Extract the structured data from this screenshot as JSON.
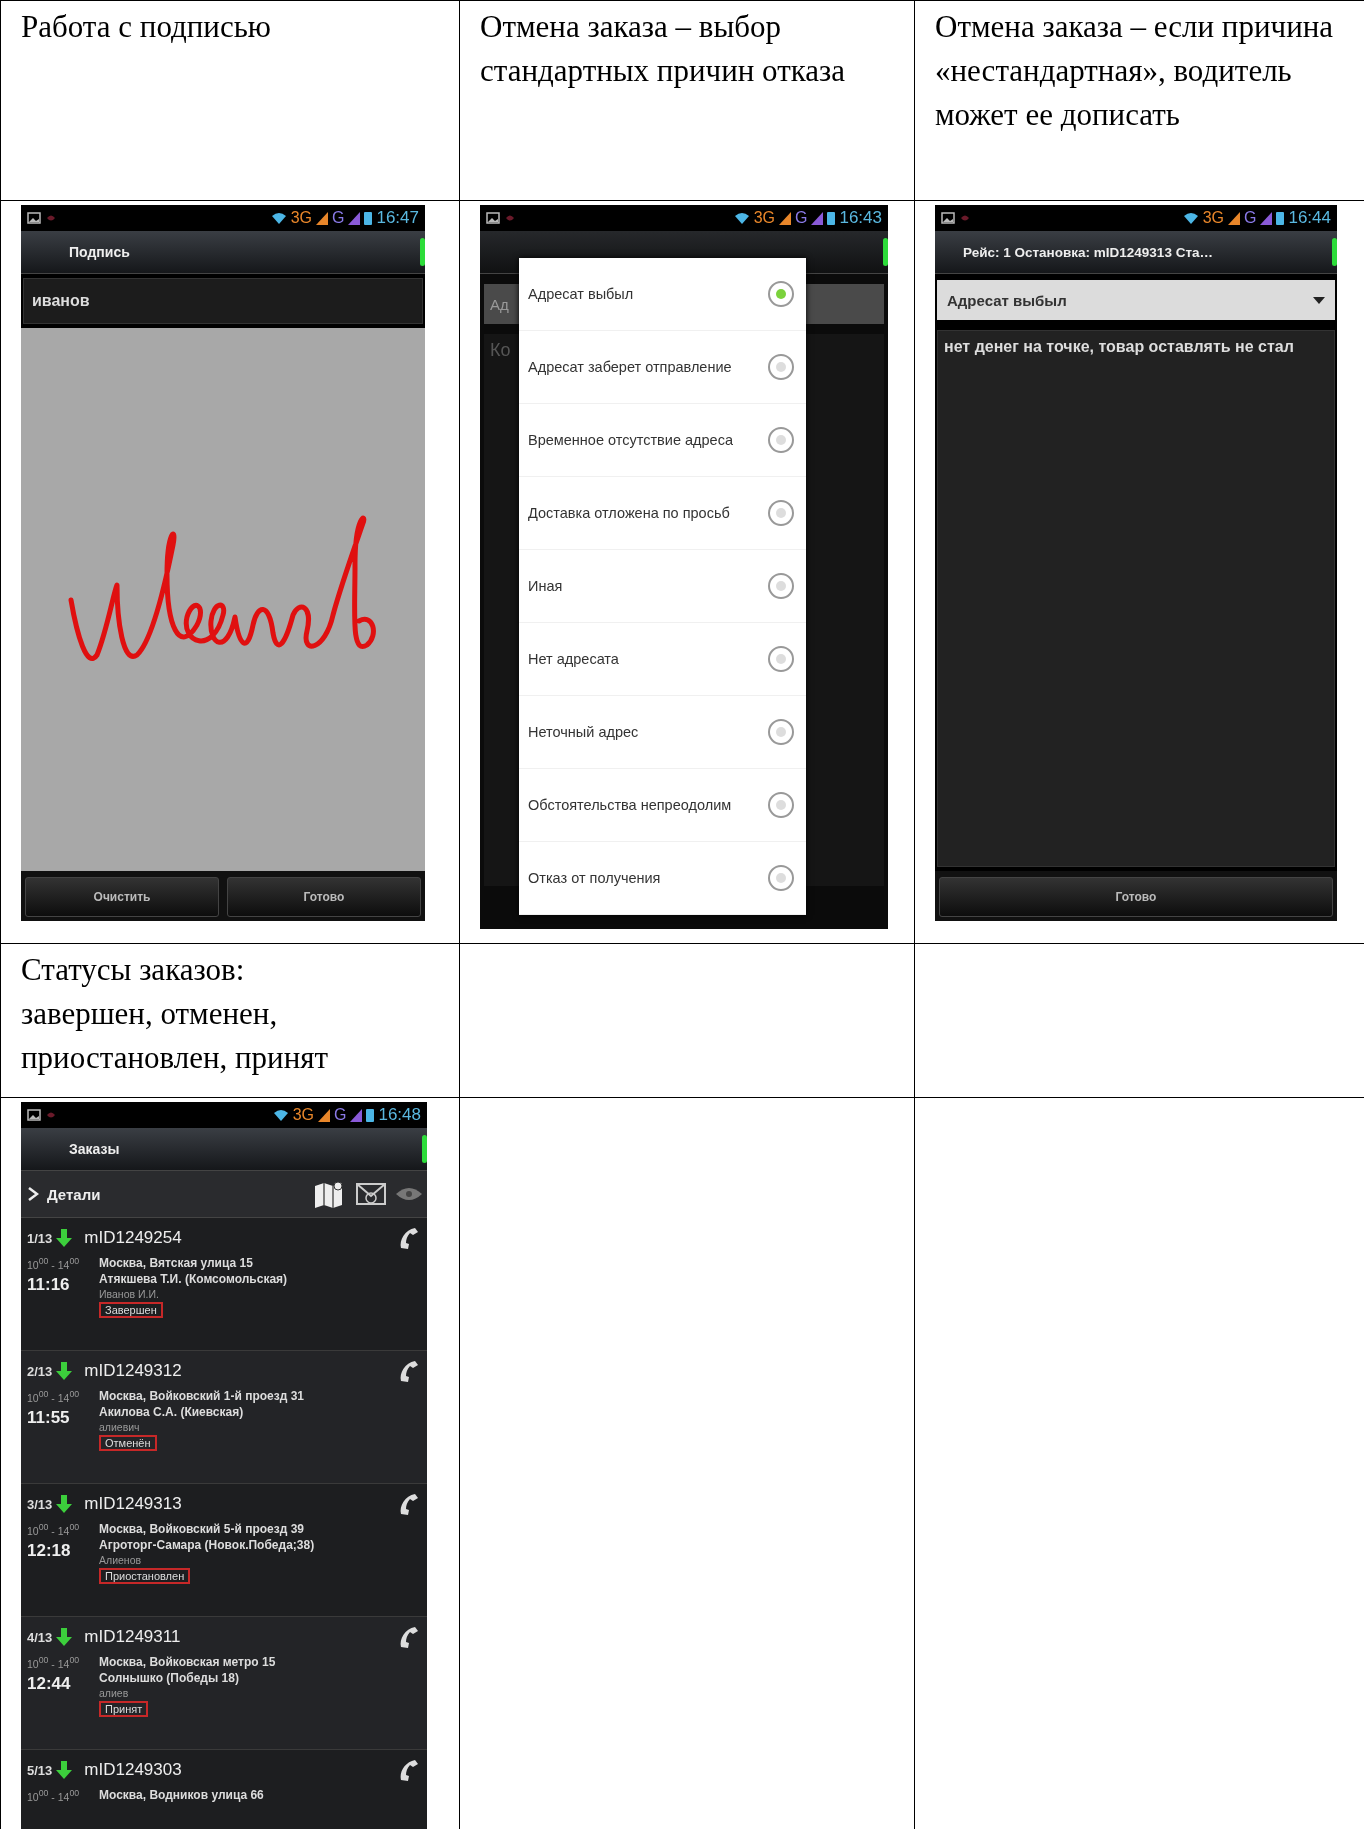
{
  "table": {
    "rows": [
      {
        "kind": "caption",
        "cells": [
          "Работа с подписью",
          "Отмена заказа – выбор стандартных причин отказа",
          "Отмена заказа – если причина «нестандартная», водитель может ее дописать"
        ]
      },
      {
        "kind": "screens",
        "cells": [
          {
            "kind": "signature",
            "status_bar": {
              "network_1": "3G",
              "network_2": "G",
              "time": "16:47"
            },
            "title": "Подпись",
            "name_value": "иванов",
            "buttons": [
              "Очистить",
              "Готово"
            ]
          },
          {
            "kind": "picker",
            "status_bar": {
              "network_1": "3G",
              "network_2": "G",
              "time": "16:43"
            },
            "behind": [
              "Ад",
              "Ко"
            ],
            "options": [
              {
                "label": "Адресат выбыл",
                "selected": true
              },
              {
                "label": "Адресат заберет отправление",
                "selected": false
              },
              {
                "label": "Временное отсутствие адреса",
                "selected": false
              },
              {
                "label": "Доставка отложена по просьб",
                "selected": false
              },
              {
                "label": "Иная",
                "selected": false
              },
              {
                "label": "Нет адресата",
                "selected": false
              },
              {
                "label": "Неточный адрес",
                "selected": false
              },
              {
                "label": "Обстоятельства непреодолим",
                "selected": false
              },
              {
                "label": "Отказ от получения",
                "selected": false
              }
            ]
          },
          {
            "kind": "comment",
            "status_bar": {
              "network_1": "3G",
              "network_2": "G",
              "time": "16:44"
            },
            "title": "Рейс: 1 Остановка: mID1249313 Ста…",
            "reason": "Адресат выбыл",
            "comment_value": "нет денег на точке,  товар оставлять не стал",
            "buttons": [
              "Готово"
            ]
          }
        ]
      },
      {
        "kind": "caption",
        "cells": [
          "Статусы заказов: завершен, отменен, приостановлен, принят"
        ]
      },
      {
        "kind": "screens",
        "cells": [
          {
            "kind": "orders",
            "status_bar": {
              "network_1": "3G",
              "network_2": "G",
              "time": "16:48"
            },
            "title": "Заказы",
            "details": "Детали",
            "orders": [
              {
                "number": "1/13",
                "id": "mID1249254",
                "window": "10$^{00}$ - 14$^{00}$",
                "time": "11:16",
                "address": "Москва, Вятская улица 15",
                "client": "Атякшева Т.И.  (Комсомольская)",
                "contact": "Иванов И.И.",
                "status": "Завершен"
              },
              {
                "number": "2/13",
                "id": "mID1249312",
                "window": "10$^{00}$ - 14$^{00}$",
                "time": "11:55",
                "address": "Москва, Войковский 1-й проезд 31",
                "client": "Акилова С.А. (Киевская)",
                "contact": "алиевич",
                "status": "Отменён"
              },
              {
                "number": "3/13",
                "id": "mID1249313",
                "window": "10$^{00}$ - 14$^{00}$",
                "time": "12:18",
                "address": "Москва, Войковский 5-й проезд 39",
                "client": "Агроторг-Самара  (Новок.Победа;38)",
                "contact": "Алиенов",
                "status": "Приостановлен"
              },
              {
                "number": "4/13",
                "id": "mID1249311",
                "window": "10$^{00}$ - 14$^{00}$",
                "time": "12:44",
                "address": "Москва, Войковская метро 15",
                "client": "Солнышко  (Победы 18)",
                "contact": "алиев",
                "status": "Принят"
              },
              {
                "number": "5/13",
                "id": "mID1249303",
                "window": "10$^{00}$ - 14$^{00}$",
                "address": "Москва, Водников улица 66"
              }
            ]
          }
        ]
      }
    ]
  }
}
